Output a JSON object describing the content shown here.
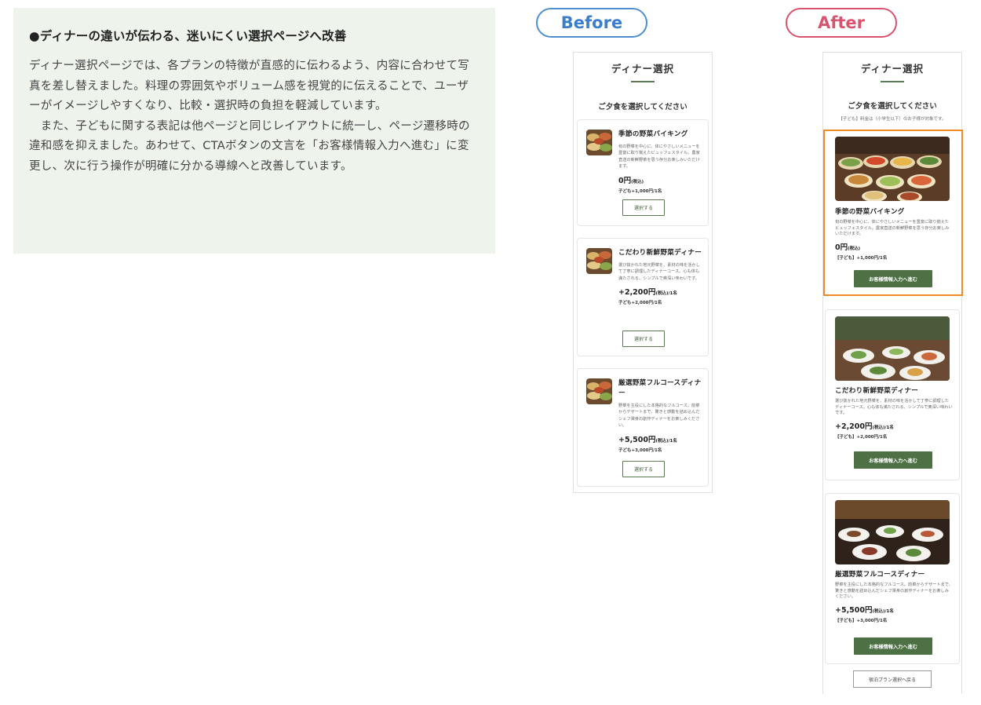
{
  "explanation": {
    "heading": "●ディナーの違いが伝わる、迷いにくい選択ページへ改善",
    "body": "ディナー選択ページでは、各プランの特徴が直感的に伝わるよう、内容に合わせて写真を差し替えました。料理の雰囲気やボリューム感を視覚的に伝えることで、ユーザーがイメージしやすくなり、比較・選択時の負担を軽減しています。\n　また、子どもに関する表記は他ページと同じレイアウトに統一し、ページ遷移時の違和感を抑えました。あわせて、CTAボタンの文言を「お客様情報入力へ進む」に変更し、次に行う操作が明確に分かる導線へと改善しています。"
  },
  "labels": {
    "before": "Before",
    "after": "After"
  },
  "colors": {
    "accent_green": "#4d7145",
    "highlight_orange": "#f08a24",
    "before_blue": "#3b7fcc",
    "after_pink": "#d9536e",
    "panel_bg": "#eef4ec"
  },
  "before": {
    "title": "ディナー選択",
    "subtitle": "ご夕食を選択してください",
    "select_label": "選択する",
    "plans": [
      {
        "name": "季節の野菜バイキング",
        "desc": "旬の野菜を中心に、体にやさしいメニューを豊富に取り揃えたビュッフェスタイル。農家直送の新鮮野菜を思う存分お楽しみいただけます。",
        "price": "0円",
        "tax": "(税込)",
        "unit": "",
        "child": "子ども+1,000円/1名"
      },
      {
        "name": "こだわり新鮮野菜ディナー",
        "desc": "選び抜かれた地元野菜を、素材の味を活かして丁寧に調理したディナーコース。心も体も満たされる、シンプルで奥深い味わいです。",
        "price": "+2,200円",
        "tax": "(税込)",
        "unit": "/1名",
        "child": "子ども+2,000円/1名"
      },
      {
        "name": "厳選野菜フルコースディナー",
        "desc": "野菜を主役にした本格的なフルコース。前菜からデザートまで、驚きと感動を詰め込んだシェフ渾身の創作ディナーをお楽しみください。",
        "price": "+5,500円",
        "tax": "(税込)",
        "unit": "/1名",
        "child": "子ども+3,000円/1名"
      }
    ]
  },
  "after": {
    "title": "ディナー選択",
    "subtitle": "ご夕食を選択してください",
    "child_note": "【子ども】料金は（小学生以下）のお子様が対象です。",
    "cta_label": "お客様情報入力へ進む",
    "back_label": "宿泊プラン選択へ戻る",
    "plans": [
      {
        "name": "季節の野菜バイキング",
        "desc": "旬の野菜を中心に、体にやさしいメニューを豊富に取り揃えたビュッフェスタイル。農家直送の新鮮野菜を思う存分お楽しみいただけます。",
        "price": "0円",
        "tax": "(税込)",
        "unit": "",
        "child": "【子ども】+1,000円/1名"
      },
      {
        "name": "こだわり新鮮野菜ディナー",
        "desc": "選び抜かれた地元野菜を、素材の味を活かして丁寧に調理したディナーコース。心も体も満たされる、シンプルで奥深い味わいです。",
        "price": "+2,200円",
        "tax": "(税込)",
        "unit": "/1名",
        "child": "【子ども】+2,000円/1名"
      },
      {
        "name": "厳選野菜フルコースディナー",
        "desc": "野菜を主役にした本格的なフルコース。前菜からデザートまで、驚きと感動を詰め込んだシェフ渾身の創作ディナーをお楽しみください。",
        "price": "+5,500円",
        "tax": "(税込)",
        "unit": "/1名",
        "child": "【子ども】+3,000円/1名"
      }
    ]
  }
}
